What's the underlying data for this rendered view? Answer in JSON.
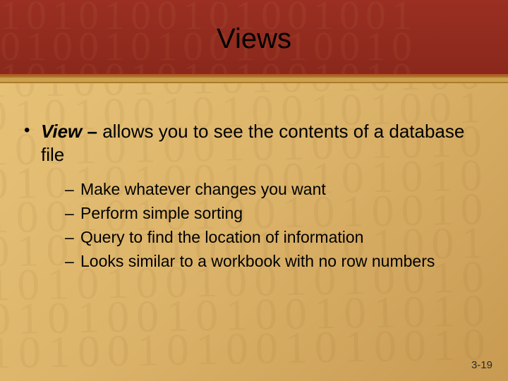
{
  "title": "Views",
  "bullet": {
    "term": "View",
    "sep": " – ",
    "definition": "allows you to see the contents of a database file"
  },
  "sub_items": [
    "Make whatever changes you want",
    "Perform simple sorting",
    "Query to find the location of information",
    "Looks similar to a workbook with no row numbers"
  ],
  "page_number": "3-19",
  "decoration": {
    "digits_body": "10101001010010010\n01001010010100101\n10100101010010100\n01010010100101001\n10010100101001010\n01010100100101010\n10010101001010010\n01001010010101001\n10101001001010010\n01010010100101010\n10100101001010010",
    "digits_header": "1010100101001001\n0100101001010010\n1010010101001010"
  }
}
